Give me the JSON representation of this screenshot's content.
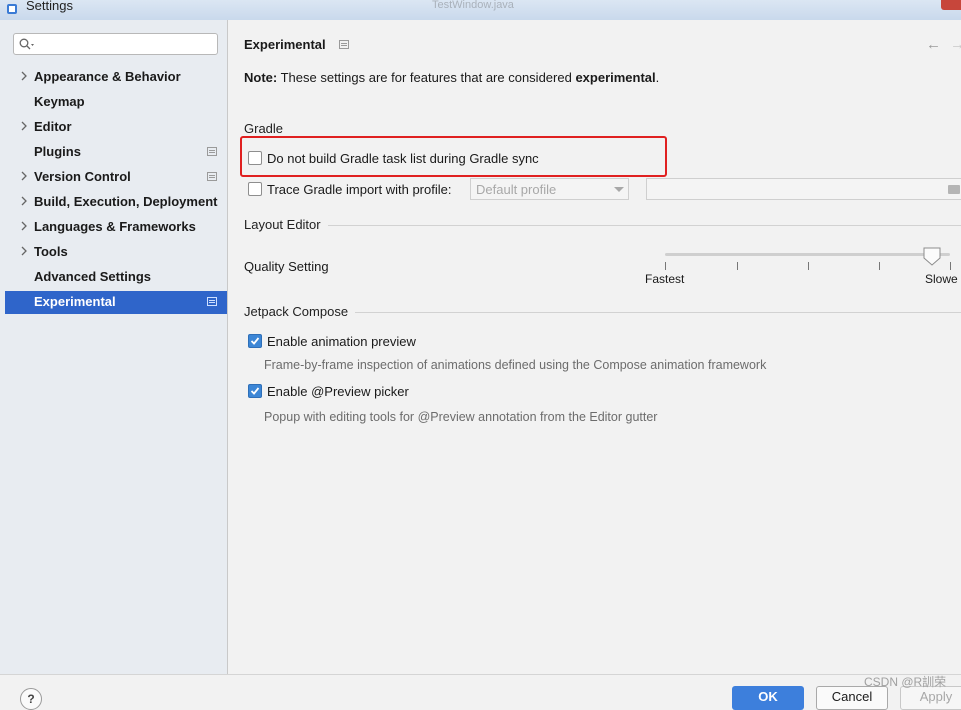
{
  "window": {
    "title": "Settings",
    "ghost_text": "TestWindow.java"
  },
  "search": {
    "placeholder": ""
  },
  "sidebar": {
    "items": [
      {
        "label": "Appearance & Behavior",
        "expandable": true,
        "has_mini_icon": false,
        "selected": false
      },
      {
        "label": "Keymap",
        "expandable": false,
        "has_mini_icon": false,
        "selected": false
      },
      {
        "label": "Editor",
        "expandable": true,
        "has_mini_icon": false,
        "selected": false
      },
      {
        "label": "Plugins",
        "expandable": false,
        "has_mini_icon": true,
        "selected": false
      },
      {
        "label": "Version Control",
        "expandable": true,
        "has_mini_icon": true,
        "selected": false
      },
      {
        "label": "Build, Execution, Deployment",
        "expandable": true,
        "has_mini_icon": false,
        "selected": false
      },
      {
        "label": "Languages & Frameworks",
        "expandable": true,
        "has_mini_icon": false,
        "selected": false
      },
      {
        "label": "Tools",
        "expandable": true,
        "has_mini_icon": false,
        "selected": false
      },
      {
        "label": "Advanced Settings",
        "expandable": false,
        "has_mini_icon": false,
        "selected": false
      },
      {
        "label": "Experimental",
        "expandable": false,
        "has_mini_icon": true,
        "selected": true
      }
    ]
  },
  "main": {
    "title": "Experimental",
    "note_prefix": "Note:",
    "note_text": " These settings are for features that are considered ",
    "note_bold": "experimental",
    "note_suffix": ".",
    "gradle": {
      "section": "Gradle",
      "no_task_list_label": "Do not build Gradle task list during Gradle sync",
      "no_task_list_checked": false,
      "trace_label": "Trace Gradle import with profile:",
      "trace_checked": false,
      "profile_value": "Default profile"
    },
    "layout_editor": {
      "section": "Layout Editor",
      "quality_label": "Quality Setting",
      "slider_min_label": "Fastest",
      "slider_max_label": "Slowe",
      "slider_value_fraction": 1.0
    },
    "compose": {
      "section": "Jetpack Compose",
      "animation_label": "Enable animation preview",
      "animation_checked": true,
      "animation_desc": "Frame-by-frame inspection of animations defined using the Compose animation framework",
      "preview_label": "Enable @Preview picker",
      "preview_checked": true,
      "preview_desc": "Popup with editing tools for @Preview annotation from the Editor gutter"
    }
  },
  "buttons": {
    "help": "?",
    "ok": "OK",
    "cancel": "Cancel",
    "apply": "Apply"
  },
  "watermark": "CSDN @R訓荣",
  "colors": {
    "accent": "#2f65ca",
    "highlight_box": "#e02020",
    "checkbox_checked": "#3c86d6"
  }
}
